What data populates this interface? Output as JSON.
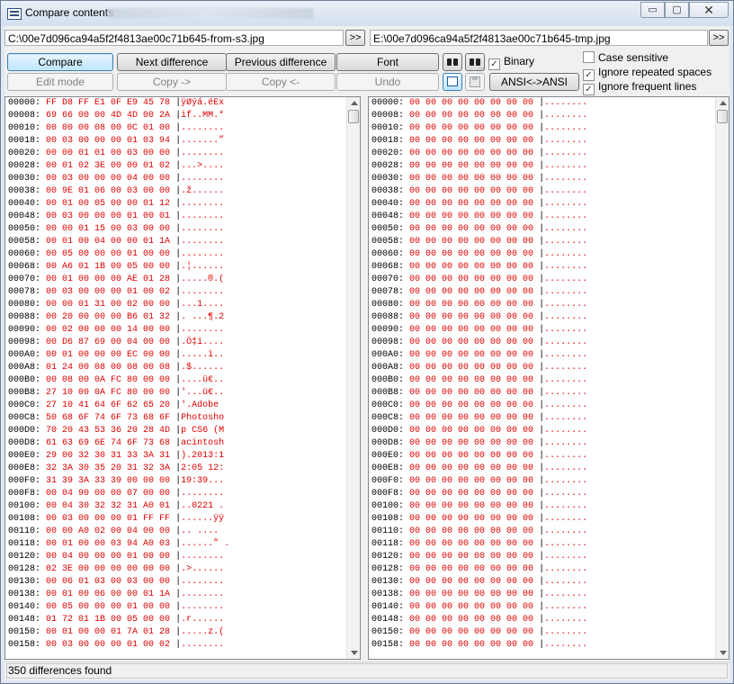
{
  "window": {
    "title": "Compare contents",
    "minimize_glyph": "▭",
    "maximize_glyph": "▢",
    "close_glyph": "✕"
  },
  "paths": {
    "left": "C:\\00e7d096ca94a5f2f4813ae00c71b645-from-s3.jpg",
    "right": "E:\\00e7d096ca94a5f2f4813ae00c71b645-tmp.jpg",
    "browse_label": ">>"
  },
  "toolbar": {
    "compare": "Compare",
    "next_difference": "Next difference",
    "previous_difference": "Previous difference",
    "font": "Font",
    "edit_mode": "Edit mode",
    "copy_right": "Copy ->",
    "copy_left": "Copy <-",
    "undo": "Undo",
    "ansi": "ANSI<->ANSI",
    "binary": "Binary",
    "binary_checked": true
  },
  "options": {
    "case_sensitive": {
      "label": "Case sensitive",
      "checked": false
    },
    "ignore_repeated_spaces": {
      "label": "Ignore repeated spaces",
      "checked": true
    },
    "ignore_frequent_lines": {
      "label": "Ignore frequent lines",
      "checked": true
    }
  },
  "left_lines": [
    {
      "addr": "00000:",
      "hex": "FF D8 FF E1 0F E9 45 78",
      "text": "ÿØÿá.éEx"
    },
    {
      "addr": "00008:",
      "hex": "69 66 00 00 4D 4D 00 2A",
      "text": "if..MM.*"
    },
    {
      "addr": "00010:",
      "hex": "00 00 00 08 00 0C 01 00",
      "text": "........"
    },
    {
      "addr": "00018:",
      "hex": "00 03 00 00 00 01 03 94",
      "text": ".......”"
    },
    {
      "addr": "00020:",
      "hex": "00 00 01 01 00 03 00 00",
      "text": "........"
    },
    {
      "addr": "00028:",
      "hex": "00 01 02 3E 00 00 01 02",
      "text": "...>...."
    },
    {
      "addr": "00030:",
      "hex": "00 03 00 00 00 04 00 00",
      "text": "........"
    },
    {
      "addr": "00038:",
      "hex": "00 9E 01 06 00 03 00 00",
      "text": ".ž......"
    },
    {
      "addr": "00040:",
      "hex": "00 01 00 05 00 00 01 12",
      "text": "........"
    },
    {
      "addr": "00048:",
      "hex": "00 03 00 00 00 01 00 01",
      "text": "........"
    },
    {
      "addr": "00050:",
      "hex": "00 00 01 15 00 03 00 00",
      "text": "........"
    },
    {
      "addr": "00058:",
      "hex": "00 01 00 04 00 00 01 1A",
      "text": "........"
    },
    {
      "addr": "00060:",
      "hex": "00 05 00 00 00 01 00 00",
      "text": "........"
    },
    {
      "addr": "00068:",
      "hex": "00 A6 01 1B 00 05 00 00",
      "text": ".¦......"
    },
    {
      "addr": "00070:",
      "hex": "00 01 00 00 00 AE 01 28",
      "text": ".....®.("
    },
    {
      "addr": "00078:",
      "hex": "00 03 00 00 00 01 00 02",
      "text": "........"
    },
    {
      "addr": "00080:",
      "hex": "00 00 01 31 00 02 00 00",
      "text": "...1...."
    },
    {
      "addr": "00088:",
      "hex": "00 20 00 00 00 B6 01 32",
      "text": ". ...¶.2"
    },
    {
      "addr": "00090:",
      "hex": "00 02 00 00 00 14 00 00",
      "text": "........"
    },
    {
      "addr": "00098:",
      "hex": "00 D6 87 69 00 04 00 00",
      "text": ".Ö‡i...."
    },
    {
      "addr": "000A0:",
      "hex": "00 01 00 00 00 EC 00 00",
      "text": ".....ì.."
    },
    {
      "addr": "000A8:",
      "hex": "01 24 00 08 00 08 00 08",
      "text": ".$......"
    },
    {
      "addr": "000B0:",
      "hex": "00 08 00 0A FC 80 00 00",
      "text": "....ü€.."
    },
    {
      "addr": "000B8:",
      "hex": "27 10 00 0A FC 80 00 00",
      "text": "'...ü€.."
    },
    {
      "addr": "000C0:",
      "hex": "27 10 41 64 6F 62 65 20",
      "text": "'.Adobe "
    },
    {
      "addr": "000C8:",
      "hex": "50 68 6F 74 6F 73 68 6F",
      "text": "Photosho"
    },
    {
      "addr": "000D0:",
      "hex": "70 20 43 53 36 20 28 4D",
      "text": "p CS6 (M"
    },
    {
      "addr": "000D8:",
      "hex": "61 63 69 6E 74 6F 73 68",
      "text": "acintosh"
    },
    {
      "addr": "000E0:",
      "hex": "29 00 32 30 31 33 3A 31",
      "text": ").2013:1"
    },
    {
      "addr": "000E8:",
      "hex": "32 3A 30 35 20 31 32 3A",
      "text": "2:05 12:"
    },
    {
      "addr": "000F0:",
      "hex": "31 39 3A 33 39 00 00 00",
      "text": "19:39..."
    },
    {
      "addr": "000F8:",
      "hex": "00 04 90 00 00 07 00 00",
      "text": "........"
    },
    {
      "addr": "00100:",
      "hex": "00 04 30 32 32 31 A0 01",
      "text": "..0221 ."
    },
    {
      "addr": "00108:",
      "hex": "00 03 00 00 00 01 FF FF",
      "text": "......ÿÿ"
    },
    {
      "addr": "00110:",
      "hex": "00 00 A0 02 00 04 00 00",
      "text": ".. ...."
    },
    {
      "addr": "00118:",
      "hex": "00 01 00 00 03 94 A0 03",
      "text": "......” ."
    },
    {
      "addr": "00120:",
      "hex": "00 04 00 00 00 01 00 00",
      "text": "........"
    },
    {
      "addr": "00128:",
      "hex": "02 3E 00 00 00 00 00 00",
      "text": ".>......"
    },
    {
      "addr": "00130:",
      "hex": "00 06 01 03 00 03 00 00",
      "text": "........"
    },
    {
      "addr": "00138:",
      "hex": "00 01 00 06 00 00 01 1A",
      "text": "........"
    },
    {
      "addr": "00140:",
      "hex": "00 05 00 00 00 01 00 00",
      "text": "........"
    },
    {
      "addr": "00148:",
      "hex": "01 72 01 1B 00 05 00 00",
      "text": ".r......"
    },
    {
      "addr": "00150:",
      "hex": "00 01 00 00 01 7A 01 28",
      "text": ".....z.("
    },
    {
      "addr": "00158:",
      "hex": "00 03 00 00 00 01 00 02",
      "text": "........"
    }
  ],
  "right_lines": [
    {
      "addr": "00000:",
      "hex": "00 00 00 00 00 00 00 00",
      "text": "........"
    },
    {
      "addr": "00008:",
      "hex": "00 00 00 00 00 00 00 00",
      "text": "........"
    },
    {
      "addr": "00010:",
      "hex": "00 00 00 00 00 00 00 00",
      "text": "........"
    },
    {
      "addr": "00018:",
      "hex": "00 00 00 00 00 00 00 00",
      "text": "........"
    },
    {
      "addr": "00020:",
      "hex": "00 00 00 00 00 00 00 00",
      "text": "........"
    },
    {
      "addr": "00028:",
      "hex": "00 00 00 00 00 00 00 00",
      "text": "........"
    },
    {
      "addr": "00030:",
      "hex": "00 00 00 00 00 00 00 00",
      "text": "........"
    },
    {
      "addr": "00038:",
      "hex": "00 00 00 00 00 00 00 00",
      "text": "........"
    },
    {
      "addr": "00040:",
      "hex": "00 00 00 00 00 00 00 00",
      "text": "........"
    },
    {
      "addr": "00048:",
      "hex": "00 00 00 00 00 00 00 00",
      "text": "........"
    },
    {
      "addr": "00050:",
      "hex": "00 00 00 00 00 00 00 00",
      "text": "........"
    },
    {
      "addr": "00058:",
      "hex": "00 00 00 00 00 00 00 00",
      "text": "........"
    },
    {
      "addr": "00060:",
      "hex": "00 00 00 00 00 00 00 00",
      "text": "........"
    },
    {
      "addr": "00068:",
      "hex": "00 00 00 00 00 00 00 00",
      "text": "........"
    },
    {
      "addr": "00070:",
      "hex": "00 00 00 00 00 00 00 00",
      "text": "........"
    },
    {
      "addr": "00078:",
      "hex": "00 00 00 00 00 00 00 00",
      "text": "........"
    },
    {
      "addr": "00080:",
      "hex": "00 00 00 00 00 00 00 00",
      "text": "........"
    },
    {
      "addr": "00088:",
      "hex": "00 00 00 00 00 00 00 00",
      "text": "........"
    },
    {
      "addr": "00090:",
      "hex": "00 00 00 00 00 00 00 00",
      "text": "........"
    },
    {
      "addr": "00098:",
      "hex": "00 00 00 00 00 00 00 00",
      "text": "........"
    },
    {
      "addr": "000A0:",
      "hex": "00 00 00 00 00 00 00 00",
      "text": "........"
    },
    {
      "addr": "000A8:",
      "hex": "00 00 00 00 00 00 00 00",
      "text": "........"
    },
    {
      "addr": "000B0:",
      "hex": "00 00 00 00 00 00 00 00",
      "text": "........"
    },
    {
      "addr": "000B8:",
      "hex": "00 00 00 00 00 00 00 00",
      "text": "........"
    },
    {
      "addr": "000C0:",
      "hex": "00 00 00 00 00 00 00 00",
      "text": "........"
    },
    {
      "addr": "000C8:",
      "hex": "00 00 00 00 00 00 00 00",
      "text": "........"
    },
    {
      "addr": "000D0:",
      "hex": "00 00 00 00 00 00 00 00",
      "text": "........"
    },
    {
      "addr": "000D8:",
      "hex": "00 00 00 00 00 00 00 00",
      "text": "........"
    },
    {
      "addr": "000E0:",
      "hex": "00 00 00 00 00 00 00 00",
      "text": "........"
    },
    {
      "addr": "000E8:",
      "hex": "00 00 00 00 00 00 00 00",
      "text": "........"
    },
    {
      "addr": "000F0:",
      "hex": "00 00 00 00 00 00 00 00",
      "text": "........"
    },
    {
      "addr": "000F8:",
      "hex": "00 00 00 00 00 00 00 00",
      "text": "........"
    },
    {
      "addr": "00100:",
      "hex": "00 00 00 00 00 00 00 00",
      "text": "........"
    },
    {
      "addr": "00108:",
      "hex": "00 00 00 00 00 00 00 00",
      "text": "........"
    },
    {
      "addr": "00110:",
      "hex": "00 00 00 00 00 00 00 00",
      "text": "........"
    },
    {
      "addr": "00118:",
      "hex": "00 00 00 00 00 00 00 00",
      "text": "........"
    },
    {
      "addr": "00120:",
      "hex": "00 00 00 00 00 00 00 00",
      "text": "........"
    },
    {
      "addr": "00128:",
      "hex": "00 00 00 00 00 00 00 00",
      "text": "........"
    },
    {
      "addr": "00130:",
      "hex": "00 00 00 00 00 00 00 00",
      "text": "........"
    },
    {
      "addr": "00138:",
      "hex": "00 00 00 00 00 00 00 00",
      "text": "........"
    },
    {
      "addr": "00140:",
      "hex": "00 00 00 00 00 00 00 00",
      "text": "........"
    },
    {
      "addr": "00148:",
      "hex": "00 00 00 00 00 00 00 00",
      "text": "........"
    },
    {
      "addr": "00150:",
      "hex": "00 00 00 00 00 00 00 00",
      "text": "........"
    },
    {
      "addr": "00158:",
      "hex": "00 00 00 00 00 00 00 00",
      "text": "........"
    }
  ],
  "status": {
    "text": "350 differences found"
  },
  "colors": {
    "diff": "#e00000",
    "equal": "#000000",
    "accent": "#3c7fb1"
  }
}
